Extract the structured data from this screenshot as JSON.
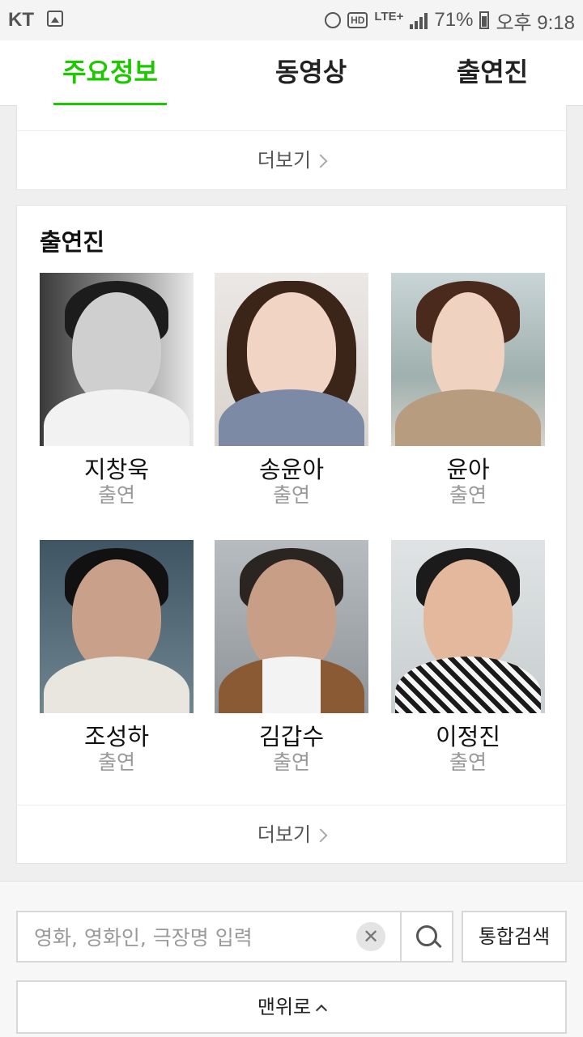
{
  "status_bar": {
    "carrier": "KT",
    "battery": "71%",
    "time": "오후 9:18",
    "network": "LTE+"
  },
  "tabs": [
    {
      "label": "주요정보",
      "active": true
    },
    {
      "label": "동영상",
      "active": false
    },
    {
      "label": "출연진",
      "active": false
    }
  ],
  "top_card": {
    "more_label": "더보기"
  },
  "cast_card": {
    "title": "출연진",
    "more_label": "더보기",
    "people": [
      {
        "name": "지창욱",
        "role": "출연"
      },
      {
        "name": "송윤아",
        "role": "출연"
      },
      {
        "name": "윤아",
        "role": "출연"
      },
      {
        "name": "조성하",
        "role": "출연"
      },
      {
        "name": "김갑수",
        "role": "출연"
      },
      {
        "name": "이정진",
        "role": "출연"
      }
    ]
  },
  "search": {
    "placeholder": "영화, 영화인, 극장명 입력",
    "clear_icon": "close-icon",
    "search_icon": "search-icon",
    "total_search_label": "통합검색"
  },
  "top_button": {
    "label": "맨위로"
  },
  "colors": {
    "accent": "#1ec800",
    "muted_text": "#999999"
  }
}
